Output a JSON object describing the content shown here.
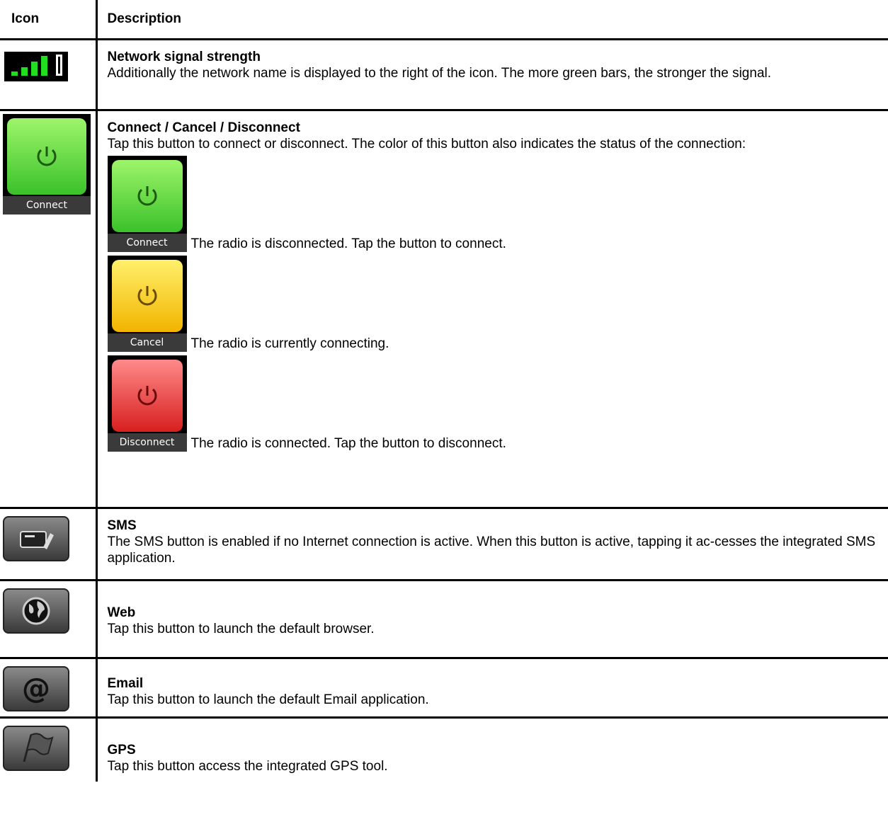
{
  "headers": {
    "icon": "Icon",
    "description": "Description"
  },
  "rows": {
    "signal": {
      "title": "Network signal strength",
      "body": "Additionally the network name is displayed to the right of the icon. The more green bars, the stronger the signal.",
      "icon": "signal-strength-icon",
      "bar_color": "#22dd22"
    },
    "connect": {
      "title": "Connect / Cancel / Disconnect",
      "body": "Tap this button to connect or disconnect. The color of this button also indicates the status of the connection:",
      "icon_label": "Connect",
      "states": [
        {
          "label": "Connect",
          "text": "The radio is disconnected. Tap the button to connect.",
          "color": "#3bc12a"
        },
        {
          "label": "Cancel",
          "text": "The radio is currently connecting.",
          "color": "#f2b400"
        },
        {
          "label": "Disconnect",
          "text": "The radio is connected. Tap the button to disconnect.",
          "color": "#d81f1f"
        }
      ]
    },
    "sms": {
      "title": "SMS",
      "body": "The SMS button is enabled if no Internet connection is active. When this button is active, tapping it ac-cesses the integrated SMS application.",
      "icon": "sms-icon"
    },
    "web": {
      "title": "Web",
      "body": "Tap this button to launch the default browser.",
      "icon": "globe-icon"
    },
    "email": {
      "title": "Email",
      "body": "Tap this button to launch the default Email application.",
      "icon": "at-sign-icon"
    },
    "gps": {
      "title": "GPS",
      "body": "Tap this button access the integrated GPS tool.",
      "icon": "flag-icon"
    }
  }
}
